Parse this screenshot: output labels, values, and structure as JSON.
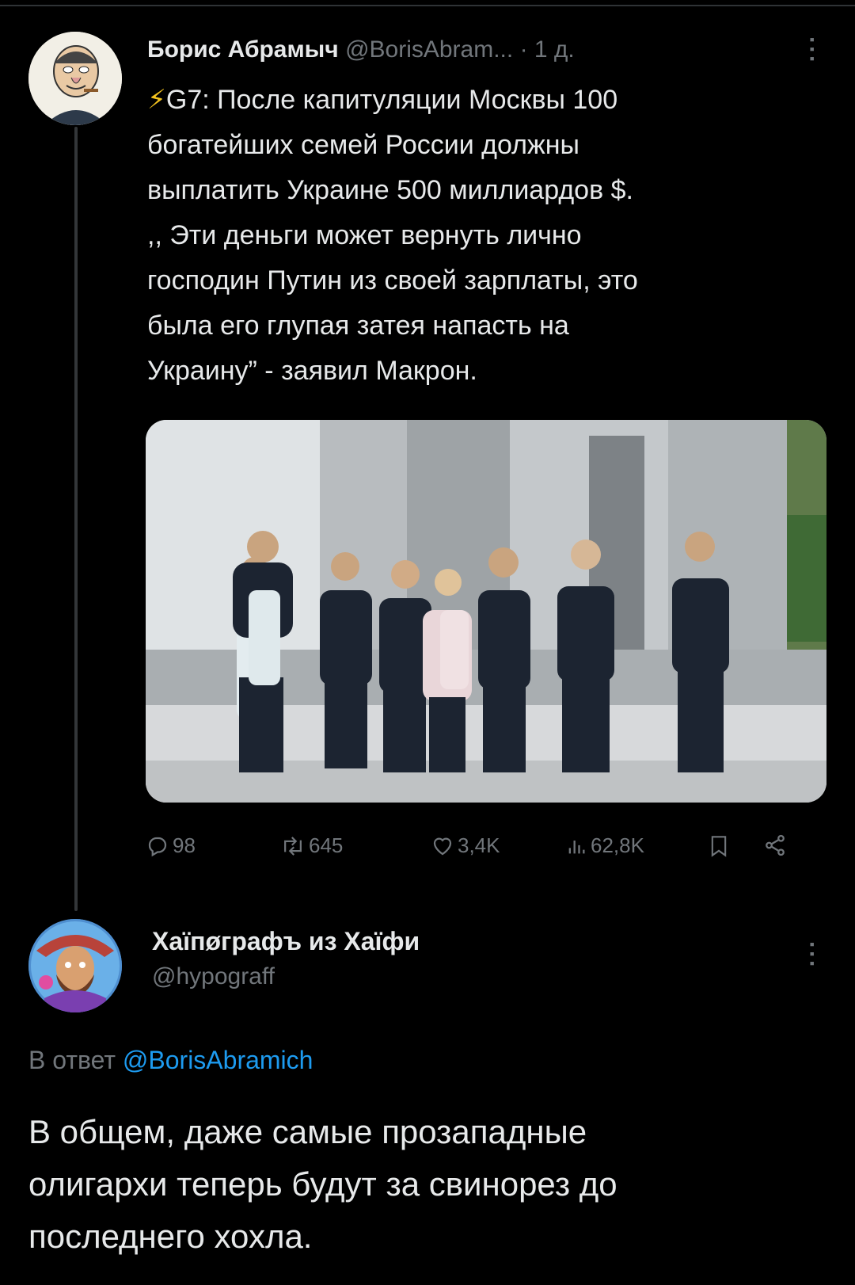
{
  "tweet": {
    "author_name": "Борис Абрамыч",
    "author_handle": "@BorisAbram...",
    "time": "· 1 д.",
    "bolt": "⚡",
    "lines": [
      "G7: После капитуляции Москвы 100",
      "богатейших семей России должны",
      "выплатить Украине 500 миллиардов $.",
      ",, Эти деньги может вернуть лично",
      "господин Путин из своей зарплаты, это",
      "была его глупая затея напасть на",
      "Украину” - заявил Макрон."
    ],
    "stats": {
      "replies": "98",
      "retweets": "645",
      "likes": "3,4K",
      "views": "62,8K"
    }
  },
  "reply": {
    "author_name": "Хаїпøграфъ из Хаїфи",
    "author_handle": "@hypograff",
    "reply_prefix": "В ответ",
    "reply_to": "@BorisAbramich",
    "lines": [
      "В общем, даже самые прозападные",
      "олигархи теперь будут за свинорез до",
      "последнего хохла."
    ]
  },
  "colors": {
    "background": "#000000",
    "text": "#e7e9ea",
    "muted": "#71767b",
    "link": "#1d9bf0",
    "bolt": "#f4c31f"
  },
  "icons": [
    "reply-icon",
    "retweet-icon",
    "like-icon",
    "views-icon",
    "bookmark-icon",
    "share-icon",
    "more-icon"
  ]
}
